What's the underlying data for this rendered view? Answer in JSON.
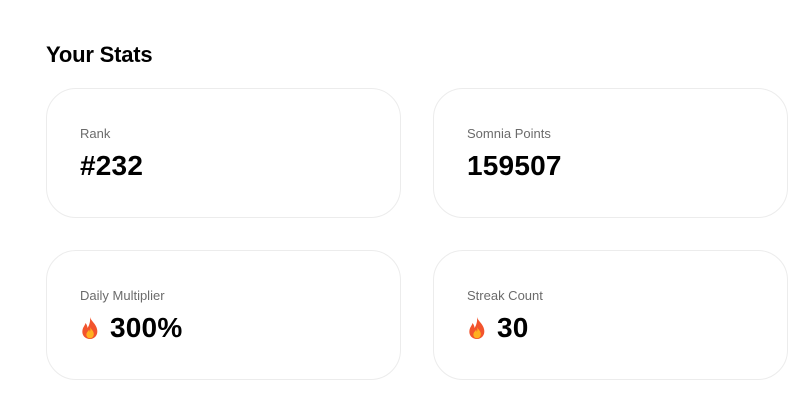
{
  "stats": {
    "title": "Your Stats",
    "cards": [
      {
        "label": "Rank",
        "value": "#232",
        "icon": null
      },
      {
        "label": "Somnia Points",
        "value": "159507",
        "icon": null
      },
      {
        "label": "Daily Multiplier",
        "value": "300%",
        "icon": "fire-icon"
      },
      {
        "label": "Streak Count",
        "value": "30",
        "icon": "fire-icon"
      }
    ]
  },
  "colors": {
    "label": "#6b6b6b",
    "value": "#000000",
    "card_border": "#ececec",
    "fire_outer": "#f2542d",
    "fire_inner": "#ffb020"
  }
}
